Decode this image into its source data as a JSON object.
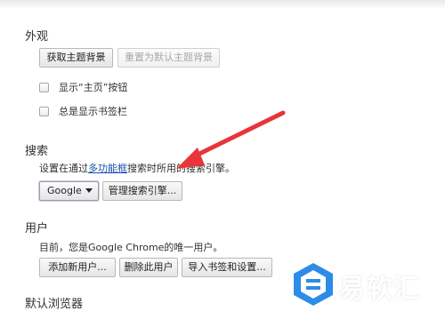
{
  "appearance": {
    "title": "外观",
    "get_themes_button": "获取主题背景",
    "reset_theme_button": "重置为默认主题背景",
    "show_home_label": "显示“主页”按钮",
    "show_bookmarks_label": "总是显示书签栏"
  },
  "search": {
    "title": "搜索",
    "desc_prefix": "设置在通过",
    "desc_link": "多功能框",
    "desc_suffix": "搜索时所用的搜索引擎。",
    "engine_selected": "Google",
    "manage_button": "管理搜索引擎..."
  },
  "users": {
    "title": "用户",
    "desc": "目前，您是Google Chrome的唯一用户。",
    "add_button": "添加新用户...",
    "delete_button": "删除此用户",
    "import_button": "导入书签和设置..."
  },
  "default_browser": {
    "title": "默认浏览器"
  },
  "watermark": {
    "text": "易软汇"
  },
  "colors": {
    "arrow": "#e8343a",
    "link": "#1a4fb0",
    "watermark_blue": "#2d8ce6"
  }
}
